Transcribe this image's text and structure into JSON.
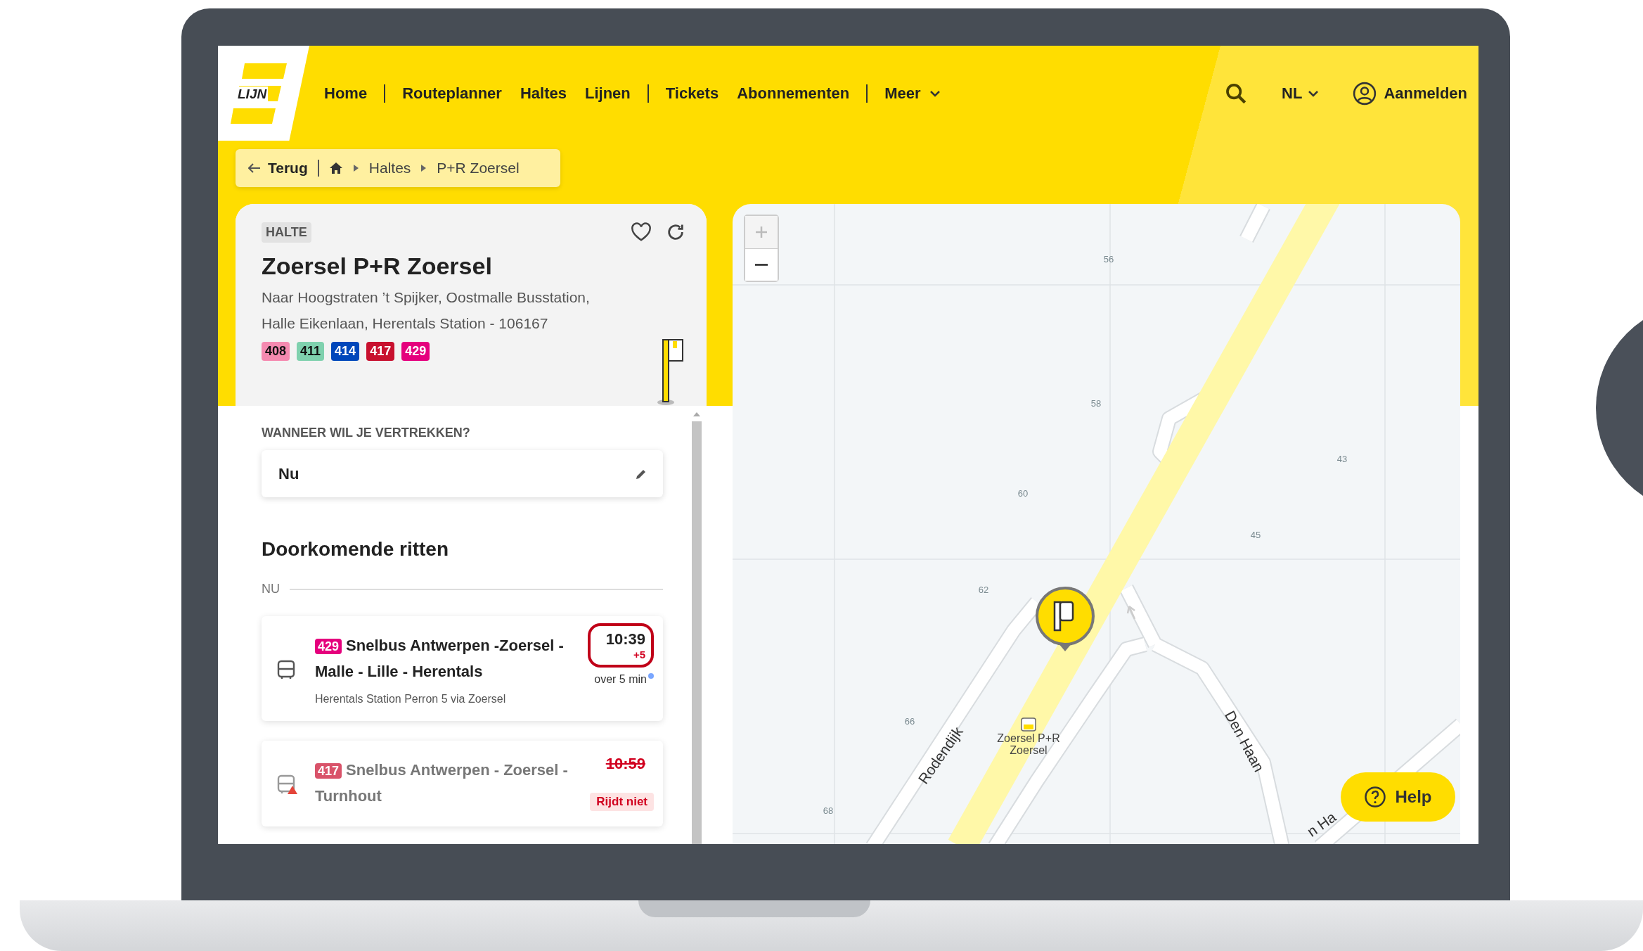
{
  "logo": {
    "text": "LIJN"
  },
  "nav": {
    "items": [
      {
        "label": "Home",
        "divider_before": false,
        "has_menu": false
      },
      {
        "label": "Routeplanner",
        "divider_before": true,
        "has_menu": false
      },
      {
        "label": "Haltes",
        "divider_before": false,
        "has_menu": false
      },
      {
        "label": "Lijnen",
        "divider_before": false,
        "has_menu": false
      },
      {
        "label": "Tickets",
        "divider_before": true,
        "has_menu": false
      },
      {
        "label": "Abonnementen",
        "divider_before": false,
        "has_menu": false
      },
      {
        "label": "Meer",
        "divider_before": true,
        "has_menu": true
      }
    ]
  },
  "actions": {
    "language": "NL",
    "login": "Aanmelden"
  },
  "breadcrumb": {
    "back": "Terug",
    "items": [
      "Haltes",
      "P+R Zoersel"
    ]
  },
  "stop": {
    "tag": "HALTE",
    "name": "Zoersel P+R Zoersel",
    "description": "Naar Hoogstraten ’t Spijker, Oostmalle Busstation, Halle Eikenlaan, Herentals Station - 106167",
    "lines": [
      {
        "number": "408",
        "color": "#f58ab0"
      },
      {
        "number": "411",
        "color": "#7fd1ae"
      },
      {
        "number": "414",
        "color": "#0047bb"
      },
      {
        "number": "417",
        "color": "#c8102e"
      },
      {
        "number": "429",
        "color": "#e5007d"
      }
    ]
  },
  "departure": {
    "label": "WANNEER WIL JE VERTREKKEN?",
    "value": "Nu"
  },
  "rides": {
    "title": "Doorkomende ritten",
    "divider_label": "NU",
    "items": [
      {
        "line": "429",
        "color": "#e5007d",
        "title": "Snelbus Antwerpen -Zoersel - Malle - Lille - Herentals",
        "subtitle": "Herentals Station Perron 5 via Zoersel",
        "time": "10:39",
        "delay": "+5",
        "eta": "over 5 min",
        "realtime": true,
        "cancelled": false,
        "circled": true
      },
      {
        "line": "417",
        "color": "#d9536a",
        "title": "Snelbus Antwerpen - Zoersel - Turnhout",
        "time": "10:59",
        "status": "Rijdt niet",
        "cancelled": true,
        "circled": false
      }
    ]
  },
  "map": {
    "labels": [
      "56",
      "58",
      "60",
      "62",
      "66",
      "68",
      "43",
      "45",
      "Rodendijk",
      "Den Haan",
      "n Ha"
    ],
    "stop_label": "Zoersel P+R Zoersel"
  },
  "help": {
    "label": "Help"
  }
}
